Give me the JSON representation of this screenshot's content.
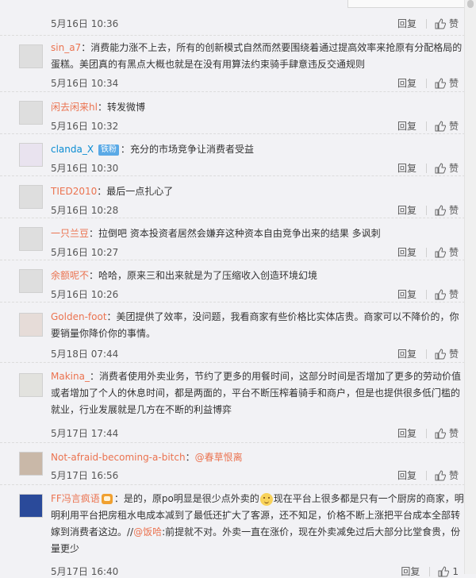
{
  "reply_label": "回复",
  "like_label": "赞",
  "top": {
    "time": "5月16日 10:36"
  },
  "comments": [
    {
      "user": "sin_a7",
      "sep": "：",
      "content": "消费能力涨不上去，所有的创新模式自然而然要围绕着通过提高效率来抢原有分配格局的蛋糕。美团真的有黑点大概也就是在没有用算法约束骑手肆意违反交通规则",
      "time": "5月16日 10:34"
    },
    {
      "user": "闲去闲来hl",
      "sep": "：",
      "content": "转发微博",
      "time": "5月16日 10:32"
    },
    {
      "user": "clanda_X",
      "badge": "铁粉",
      "sep": "：",
      "content": "充分的市场竞争让消费者受益",
      "time": "5月16日 10:30"
    },
    {
      "user": "TIED2010",
      "sep": "：",
      "content": "最后一点扎心了",
      "time": "5月16日 10:28"
    },
    {
      "user": "一只兰豆",
      "sep": "：",
      "content": "拉倒吧 资本投资者居然会嫌弃这种资本自由竞争出来的结果 多讽刺",
      "time": "5月16日 10:27"
    },
    {
      "user": "余额呢不",
      "sep": "：",
      "content": "哈哈，原来三和出来就是为了压缩收入创造环境幻境",
      "time": "5月16日 10:26"
    },
    {
      "user": "Golden-foot",
      "sep": "：",
      "content": "美团提供了效率，没问题，我看商家有些价格比实体店贵。商家可以不降价的，你要销量你降价你的事情。",
      "time": "5月18日 07:44"
    },
    {
      "user": "Makina_",
      "sep": "：",
      "content": "消费者使用外卖业务，节约了更多的用餐时间，这部分时间是否增加了更多的劳动价值或者增加了个人的休息时间，都是两面的，平台不断压榨着骑手和商户，但是也提供很多低门槛的就业，行业发展就是几方在不断的利益博弈",
      "time": "5月17日 17:44"
    },
    {
      "user": "Not-afraid-becoming-a-bitch",
      "sep": "：",
      "at": "@春草恨离",
      "content": "",
      "time": "5月17日 16:56"
    },
    {
      "user": "FF冯言疯语",
      "sep": "：",
      "content_a": "是的，原po明显是很少点外卖的",
      "content_b": "现在平台上很多都是只有一个厨房的商家，明明利用平台把房租水电成本减到了最低还扩大了客源，还不知足，价格不断上涨把平台成本全部转嫁到消费者这边。//",
      "at": "@饭哈",
      "content_c": ":前提就不对。外卖一直在涨价，现在外卖减免过后大部分比堂食贵，份量更少",
      "time": "5月17日 16:40",
      "likes": "1"
    }
  ]
}
